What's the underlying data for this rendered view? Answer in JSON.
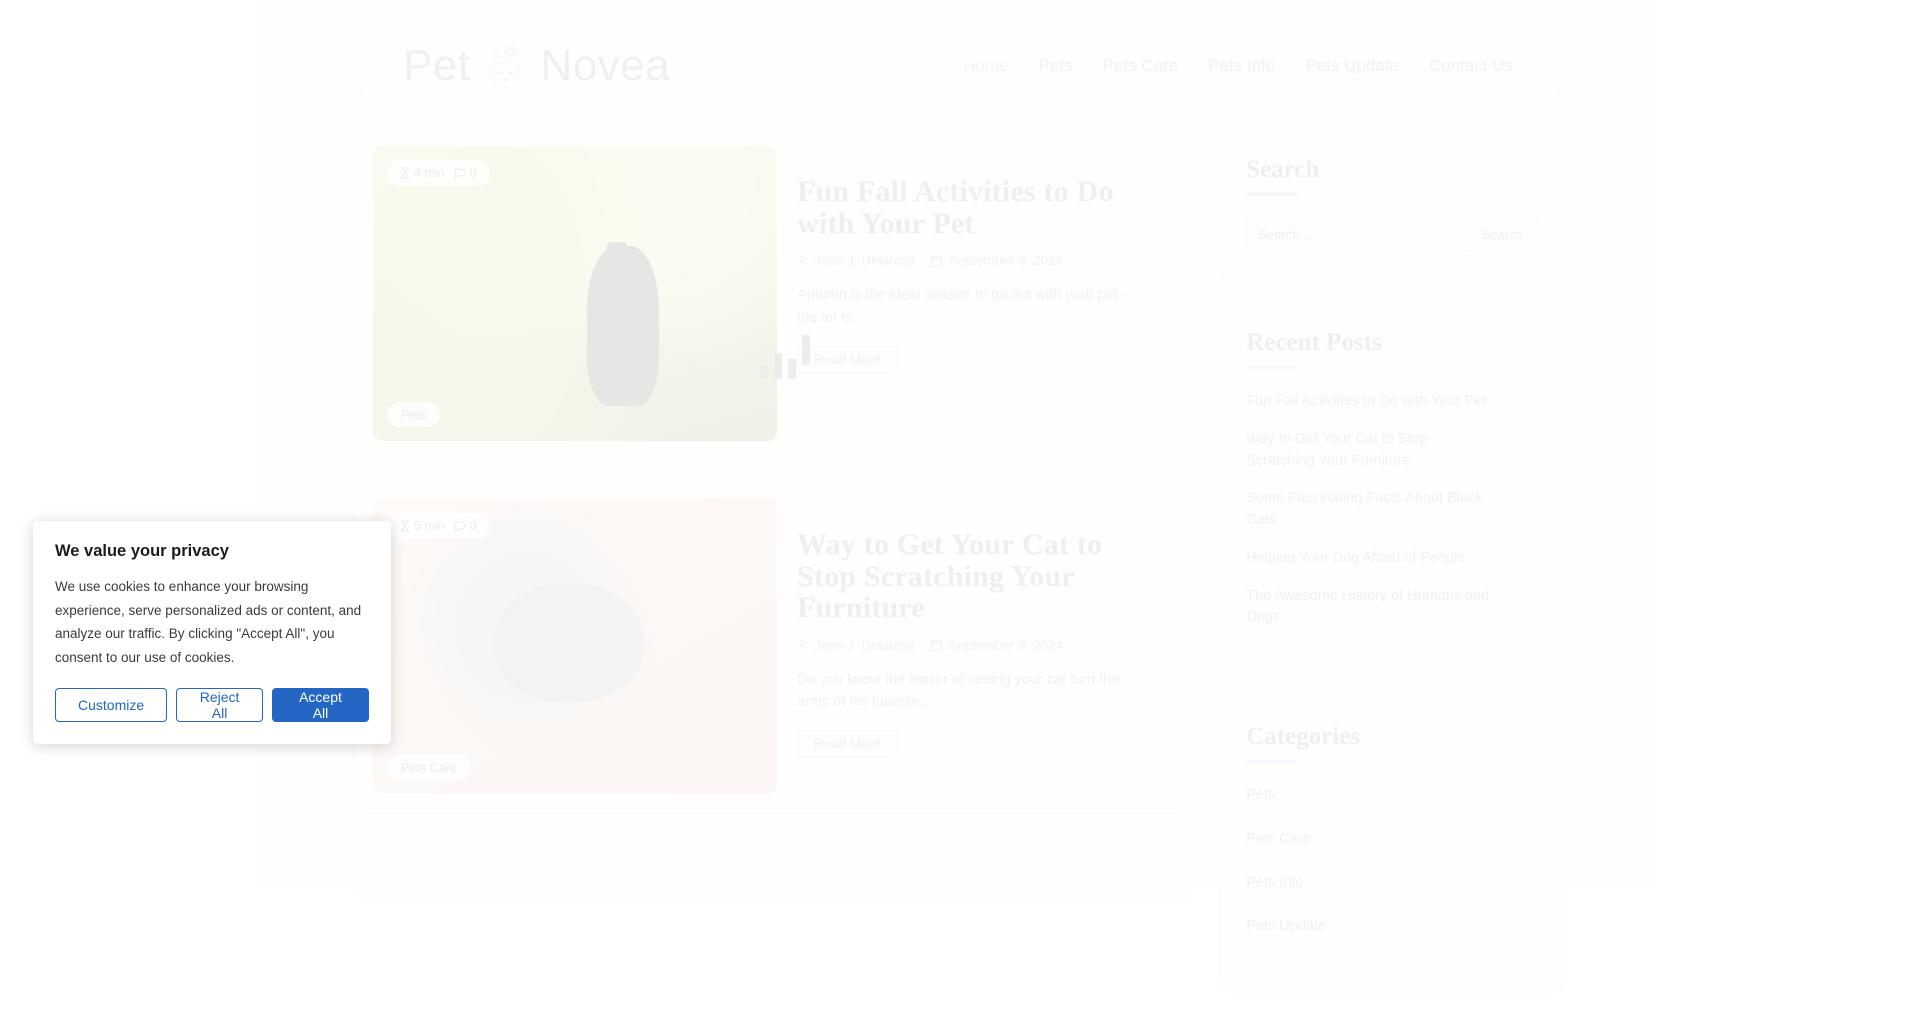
{
  "site": {
    "logo_text_left": "Pet",
    "logo_text_right": "Novea"
  },
  "nav": {
    "items": [
      {
        "label": "Home",
        "active": true
      },
      {
        "label": "Pets",
        "active": false
      },
      {
        "label": "Pets Care",
        "active": false
      },
      {
        "label": "Pets Info",
        "active": false
      },
      {
        "label": "Pets Update",
        "active": false
      },
      {
        "label": "Contact Us",
        "active": false
      }
    ]
  },
  "posts": [
    {
      "read_time": "4 min",
      "comments": "0",
      "category": "Pets",
      "title": "Fun Fall Activities to Do with Your Pet",
      "author": "Jean J. Delarosa",
      "date": "September 9, 2024",
      "excerpt": "Autumn is the ideal season to go out with your pet – the air is...",
      "read_more": "Read More"
    },
    {
      "read_time": "5 min",
      "comments": "0",
      "category": "Pets Care",
      "title": "Way to Get Your Cat to Stop Scratching Your Furniture",
      "author": "Jean J. Delarosa",
      "date": "September 9, 2024",
      "excerpt": "Do you know the horror of seeing your cat turn the arms of his favorite...",
      "read_more": "Read More"
    }
  ],
  "sidebar": {
    "search": {
      "title": "Search",
      "placeholder": "Search ...",
      "button": "Search"
    },
    "recent": {
      "title": "Recent Posts",
      "items": [
        "Fun Fall Activities to Do with Your Pet",
        "Way to Get Your Cat to Stop Scratching Your Furniture",
        "Some Fascinating Facts About Black Cats",
        "Helping Your Dog Afraid of People",
        "The Awesome History of Humans and Dogs"
      ]
    },
    "categories": {
      "title": "Categories",
      "items": [
        "Pets",
        "Pets Care",
        "Pets Info",
        "Pets Update"
      ]
    }
  },
  "cookie": {
    "title": "We value your privacy",
    "body": "We use cookies to enhance your browsing experience, serve personalized ads or content, and analyze our traffic. By clicking \"Accept All\", you consent to our use of cookies.",
    "customize": "Customize",
    "reject": "Reject All",
    "accept": "Accept All"
  },
  "colors": {
    "accent_blue": "#2466c4",
    "rule_blue": "#a8bcdf",
    "page_bg": "#fffdf7",
    "card_bg": "#fffcf4"
  }
}
